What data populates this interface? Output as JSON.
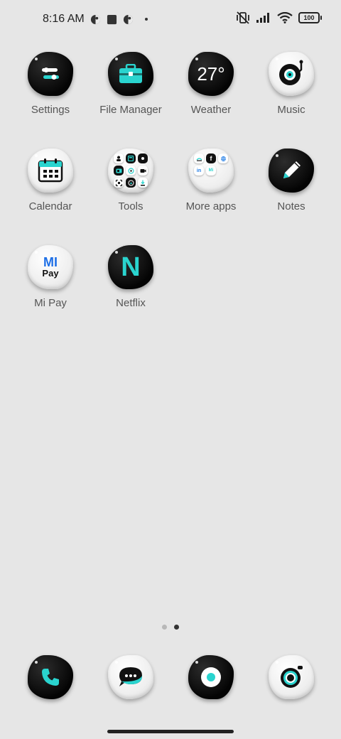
{
  "status_bar": {
    "time": "8:16 AM",
    "battery": "100"
  },
  "apps": [
    {
      "label": "Settings"
    },
    {
      "label": "File Manager"
    },
    {
      "label": "Weather",
      "icon_text": "27°"
    },
    {
      "label": "Music"
    },
    {
      "label": "Calendar"
    },
    {
      "label": "Tools"
    },
    {
      "label": "More apps"
    },
    {
      "label": "Notes"
    },
    {
      "label": "Mi Pay",
      "icon_text_top": "MI",
      "icon_text_bottom": "Pay"
    },
    {
      "label": "Netflix",
      "icon_text": "N"
    }
  ],
  "more_apps_folder": {
    "mini_labels": [
      "f",
      "in",
      "Mi"
    ]
  },
  "dock": [
    {
      "name": "phone"
    },
    {
      "name": "messages"
    },
    {
      "name": "browser"
    },
    {
      "name": "camera"
    }
  ],
  "page_indicator": {
    "pages": 2,
    "active": 2
  },
  "colors": {
    "background": "#e6e6e6",
    "accent": "#2ad4cf",
    "icon_dark": "#0a0a0a",
    "icon_light": "#f4f4f4",
    "label": "#555555"
  }
}
